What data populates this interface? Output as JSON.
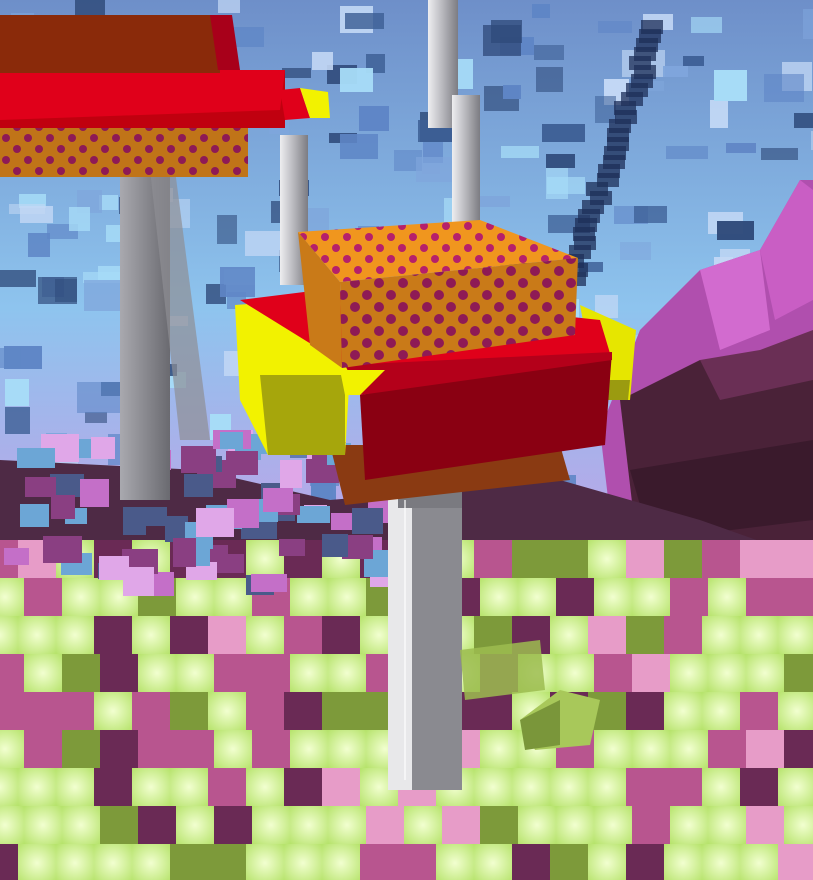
{
  "scene": {
    "title": "",
    "colors": {
      "sky_top": "#6e8fc9",
      "sky_mid": "#8ec4ee",
      "sky_low": "#b9a6e8",
      "voxel_blue_dark": "#2f4a7a",
      "voxel_blue_mid": "#5f86c6",
      "voxel_blue_light": "#a7dcf7",
      "magenta_cliff": "#b04fae",
      "magenta_dark": "#3a1e2e",
      "ground_green": "#d8f79a",
      "ground_green_dark": "#7d9a3a",
      "ground_pink": "#b8558f",
      "ground_pink_dark": "#6a2a55",
      "pillar_light": "#e8e8ea",
      "pillar_mid": "#b3b3b8",
      "pillar_dark": "#7c7c82",
      "orange_block": "#f0961e",
      "orange_block_side": "#c97a18",
      "dots": "#b6206a",
      "red_block": "#e0001a",
      "red_block_dark": "#8a0012",
      "yellow_block": "#f2f200",
      "yellow_block_dark": "#8a8a10",
      "brown_ledge": "#8a3a12"
    },
    "objects": [
      {
        "name": "central-platform",
        "description_type": "floating-block-stack"
      },
      {
        "name": "left-platform",
        "description_type": "floating-block-stack"
      },
      {
        "name": "stone-pillar",
        "description_type": "support-column"
      }
    ]
  }
}
